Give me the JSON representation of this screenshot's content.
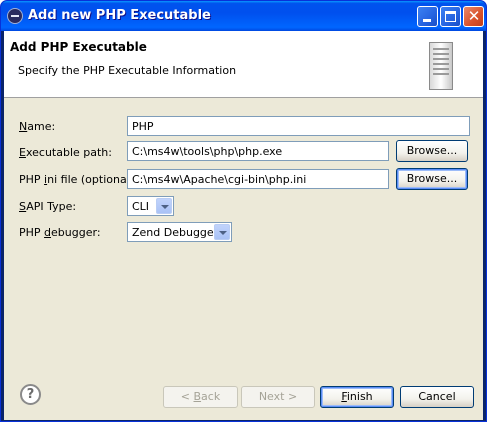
{
  "window": {
    "title": "Add new PHP Executable",
    "icon": "eclipse-icon",
    "controls": {
      "minimize": "minimize-icon",
      "maximize": "maximize-icon",
      "close": "close-icon",
      "close_glyph": "✕"
    }
  },
  "header": {
    "title": "Add PHP Executable",
    "subtitle": "Specify the PHP Executable Information",
    "icon": "server-icon"
  },
  "form": {
    "name": {
      "label_pre": "",
      "label_u": "N",
      "label_post": "ame:",
      "value": "PHP"
    },
    "exec_path": {
      "label_pre": "",
      "label_u": "E",
      "label_post": "xecutable path:",
      "value": "C:\\ms4w\\tools\\php\\php.exe",
      "browse": "Browse..."
    },
    "ini_file": {
      "label_pre": "PHP ",
      "label_u": "i",
      "label_post": "ni file (optional):",
      "value": "C:\\ms4w\\Apache\\cgi-bin\\php.ini",
      "browse": "Browse..."
    },
    "sapi": {
      "label_pre": "",
      "label_u": "S",
      "label_post": "API Type:",
      "value": "CLI"
    },
    "debugger": {
      "label_pre": "PHP ",
      "label_u": "d",
      "label_post": "ebugger:",
      "value": "Zend Debugger"
    }
  },
  "footer": {
    "help_glyph": "?",
    "back": {
      "pre": "< ",
      "u": "B",
      "post": "ack"
    },
    "next": "Next >",
    "finish": {
      "pre": "",
      "u": "F",
      "post": "inish"
    },
    "cancel": "Cancel"
  },
  "colors": {
    "title_bar": "#0054e3",
    "dialog_bg": "#ece9d8",
    "default_button_highlight": "#5b8df6"
  }
}
